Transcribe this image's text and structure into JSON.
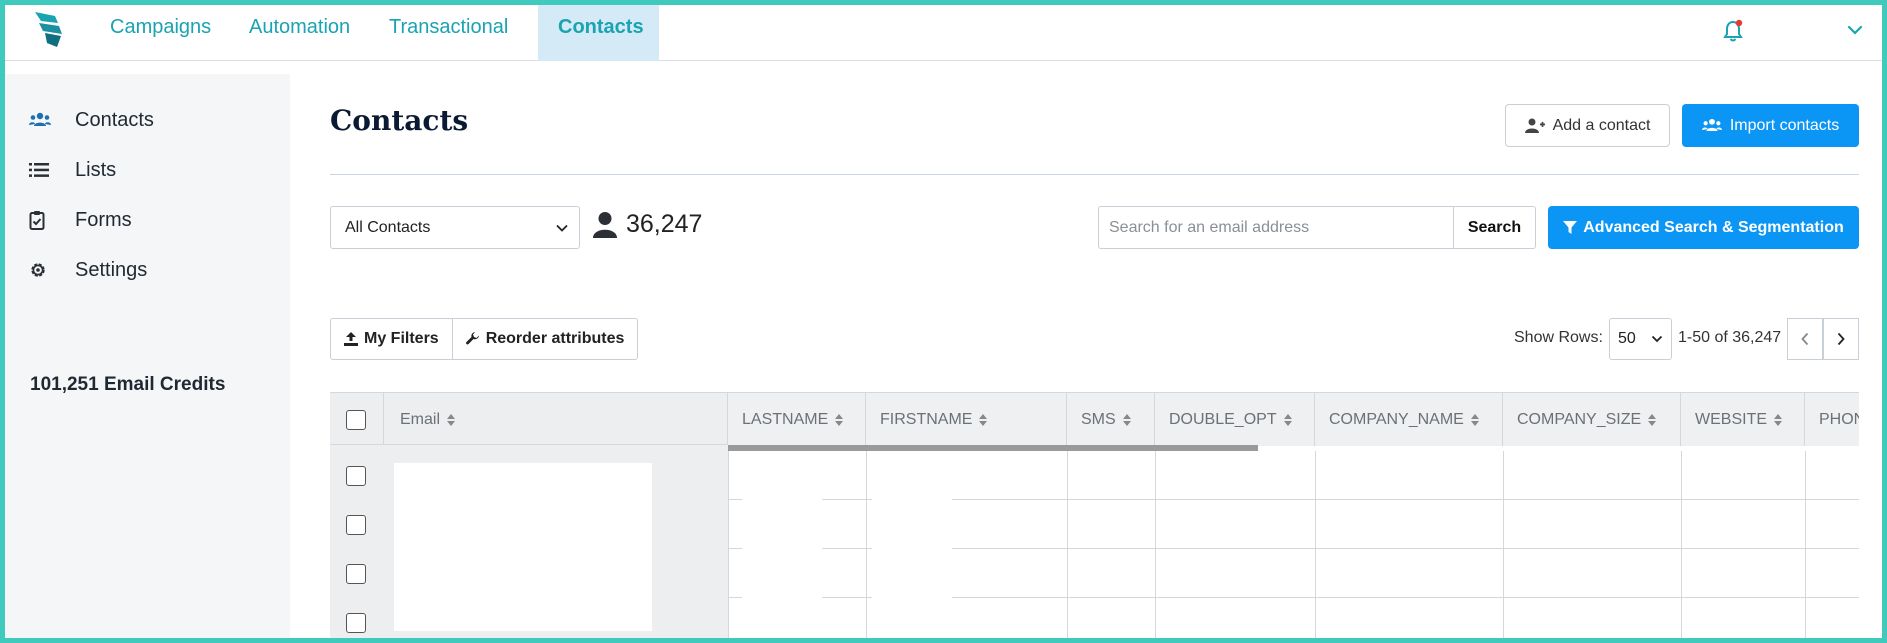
{
  "nav": {
    "tabs": [
      {
        "label": "Campaigns",
        "active": false
      },
      {
        "label": "Automation",
        "active": false
      },
      {
        "label": "Transactional",
        "active": false
      },
      {
        "label": "Contacts",
        "active": true
      }
    ],
    "icons": [
      "brevo-logo-icon",
      "bell-icon",
      "chevron-down-icon"
    ]
  },
  "sidebar": {
    "items": [
      {
        "label": "Contacts",
        "icon": "users-icon"
      },
      {
        "label": "Lists",
        "icon": "list-icon"
      },
      {
        "label": "Forms",
        "icon": "clipboard-check-icon"
      },
      {
        "label": "Settings",
        "icon": "gear-icon"
      }
    ],
    "credits": "101,251 Email Credits"
  },
  "main": {
    "title": "Contacts",
    "add_contact": "Add a contact",
    "import_contacts": "Import contacts",
    "contact_filter": "All Contacts",
    "contact_count": "36,247",
    "search": {
      "placeholder": "Search for an email address",
      "button": "Search"
    },
    "advanced": "Advanced Search & Segmentation",
    "my_filters": "My Filters",
    "reorder": "Reorder attributes",
    "show_rows_label": "Show Rows:",
    "rows_value": "50",
    "range": "1-50 of 36,247"
  },
  "table": {
    "columns": [
      "Email",
      "LASTNAME",
      "FIRSTNAME",
      "SMS",
      "DOUBLE_OPT",
      "COMPANY_NAME",
      "COMPANY_SIZE",
      "WEBSITE",
      "PHONE"
    ]
  },
  "colors": {
    "accent": "#0b96f5",
    "nav_text": "#1aa3b0",
    "frame": "#40c9bd",
    "notification_dot": "#e53935"
  }
}
